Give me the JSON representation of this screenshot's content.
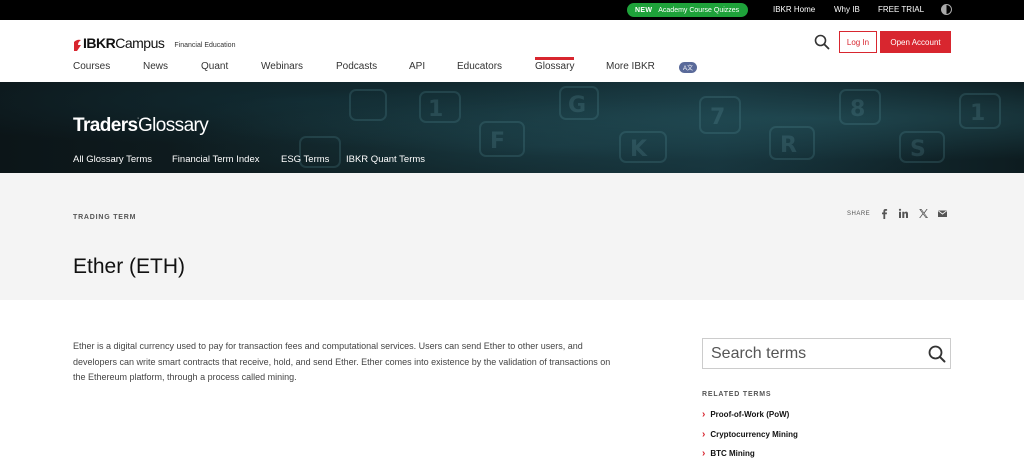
{
  "topbar": {
    "promo_badge": "NEW",
    "promo_text": "Academy Course Quizzes",
    "links": [
      "IBKR Home",
      "Why IB",
      "FREE TRIAL"
    ]
  },
  "header": {
    "logo_brand": "IBKR",
    "logo_campus": "Campus",
    "logo_subtitle": "Financial Education",
    "login_label": "Log In",
    "open_account_label": "Open Account",
    "nav": [
      "Courses",
      "News",
      "Quant",
      "Webinars",
      "Podcasts",
      "API",
      "Educators",
      "Glossary",
      "More IBKR"
    ],
    "active_nav": "Glossary",
    "lang_badge": "A文"
  },
  "hero": {
    "title_bold": "Traders",
    "title_sup": "'",
    "title_rest": "Glossary",
    "links": [
      "All Glossary Terms",
      "Financial Term Index",
      "ESG Terms",
      "IBKR Quant Terms"
    ]
  },
  "term": {
    "category": "TRADING TERM",
    "share_label": "SHARE",
    "title": "Ether (ETH)",
    "description": "Ether is a digital currency used to pay for transaction fees and computational services. Users can send Ether to other users, and developers can write smart contracts that receive, hold, and send Ether. Ether comes into existence by the validation of transactions on the Ethereum platform, through a process called mining."
  },
  "sidebar": {
    "search_placeholder": "Search terms",
    "related_title": "RELATED TERMS",
    "related": [
      "Proof-of-Work (PoW)",
      "Cryptocurrency Mining",
      "BTC Mining"
    ]
  },
  "colors": {
    "accent": "#d8262f",
    "promo_green": "#1ea23a",
    "hero_dark": "#102226"
  }
}
